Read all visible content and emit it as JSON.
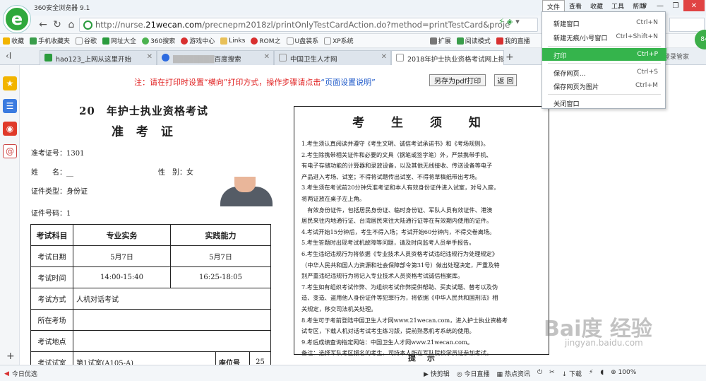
{
  "browser": {
    "app_title": "360安全浏览器 9.1",
    "menu": [
      "文件",
      "查看",
      "收藏",
      "工具",
      "帮助"
    ],
    "url_prefix": "http://nurse.",
    "url_domain": "21wecan.com",
    "url_suffix": "/precnepm2018zl/printOnlyTestCardAction.do?method=printTestCard&proje",
    "bookmarks": [
      "收藏",
      "手机收藏夹",
      "谷歌",
      "网址大全",
      "360搜索",
      "游戏中心",
      "Links",
      "ROM之",
      "U盘装系",
      "XP系统",
      "扩展",
      "阅读模式",
      "我的直播"
    ],
    "tabs": [
      {
        "label": "hao123_上网从这里开始"
      },
      {
        "label": "百度搜索"
      },
      {
        "label": "中国卫生人才网"
      },
      {
        "label": "2018年护士执业资格考试网上报"
      }
    ],
    "tabbar_right": "登录管家",
    "user_badge": "84"
  },
  "dropdown": {
    "items": [
      {
        "label": "新建窗口",
        "shortcut": "Ctrl+N"
      },
      {
        "label": "新建无痕/小号窗口",
        "shortcut": "Ctrl+Shift+N"
      },
      {
        "label": "打印",
        "shortcut": "Ctrl+P"
      },
      {
        "label": "保存网页...",
        "shortcut": "Ctrl+S"
      },
      {
        "label": "保存网页为图片",
        "shortcut": "Ctrl+M"
      },
      {
        "label": "关闭窗口",
        "shortcut": ""
      }
    ],
    "highlighted": "打印"
  },
  "page": {
    "notice": "注：请在打印时设置“横向”打印方式，操作步骤请点击",
    "notice_link": "“页面设置说明”",
    "pdf_button": "另存为pdf打印",
    "back_button": "返 回",
    "year_title": "20　年护士执业资格考试",
    "card_title": "准 考 证",
    "ticket_no_label": "准考证号：",
    "ticket_no": "1301",
    "name_label": "姓　　名：",
    "name_value": "__",
    "gender_label": "性　别：",
    "gender_value": "女",
    "id_type_label": "证件类型：",
    "id_type": "身份证",
    "id_no_label": "证件号码：",
    "id_no": "1",
    "table": {
      "header": [
        "考试科目",
        "专业实务",
        "实践能力"
      ],
      "date_label": "考试日期",
      "dates": [
        "5月7日",
        "5月7日"
      ],
      "time_label": "考试时间",
      "times": [
        "14:00-15:40",
        "16:25-18:05"
      ],
      "method_label": "考试方式",
      "method": "人机对话考试",
      "center_label": "所在考场",
      "place_label": "考试地点",
      "room_label": "考试试室",
      "room": "第1试室(A105-A)",
      "seat_label": "座位号",
      "seat": "25"
    },
    "instructions_title": "考 生 须 知",
    "instructions": [
      "1.考生须认真阅读并遵守《考生文明、诚信考试承诺书》和《考场规则》。",
      "2.考生除携带相关证件和必要的文具（钢笔或签字笔）外，严禁携带手机、",
      "有电子存储功能的计算器和录放设备，以及其他无线接收、传送设备等电子",
      "产品进入考场、试室；不得将试题传出试室、不得将草稿纸带出考场。",
      "3.考生须在考试前20分钟凭准考证和本人有效身份证件进入试室，对号入座，",
      "将两证放在桌子左上角。",
      "　有效身份证件，包括居民身份证、临时身份证、军队人员有效证件、港澳",
      "居民来往内地通行证、台湾居民来往大陆通行证等在有效期内使用的证件。",
      "4.考试开始15分钟后，考生不得入场；考试开始60分钟内，不得交卷离场。",
      "5.考生答题时出现考试机故障等问题，请及时向监考人员举手报告。",
      "6.考生违纪违规行为将依据《专业技术人员资格考试违纪违规行为处理规定》",
      "（中华人民共和国人力资源和社会保障部令第31号）做出处理决定，严重及特",
      "别严重违纪违规行为将记入专业技术人员资格考试诚信档案库。",
      "7.考生如有组织考试作弊、为组织考试作弊提供帮助、买卖试题、替考以及伪",
      "造、变造、盗用他人身份证件等犯罪行为，将依据《中华人民共和国刑法》相",
      "关规定，移交司法机关处理。",
      "8.考生可于考前登陆中国卫生人才网www.21wecan.com，进入护士执业资格考",
      "试专区，下载人机对话考试考生练习版，提前熟悉机考系统的使用。",
      "9.考后成绩查询指定网站：中国卫生人才网www.21wecan.com。",
      "备注：选择军队考区报名的考生，司持本人所在军队院校学员证参加考试。"
    ],
    "tip": "提 示"
  },
  "status": {
    "left": "今日优选",
    "right": [
      "快剪辑",
      "今日直播",
      "热点资讯",
      "下载",
      "100%"
    ]
  },
  "watermark": {
    "main": "Bai度 经验",
    "sub": "jingyan.baidu.com"
  }
}
